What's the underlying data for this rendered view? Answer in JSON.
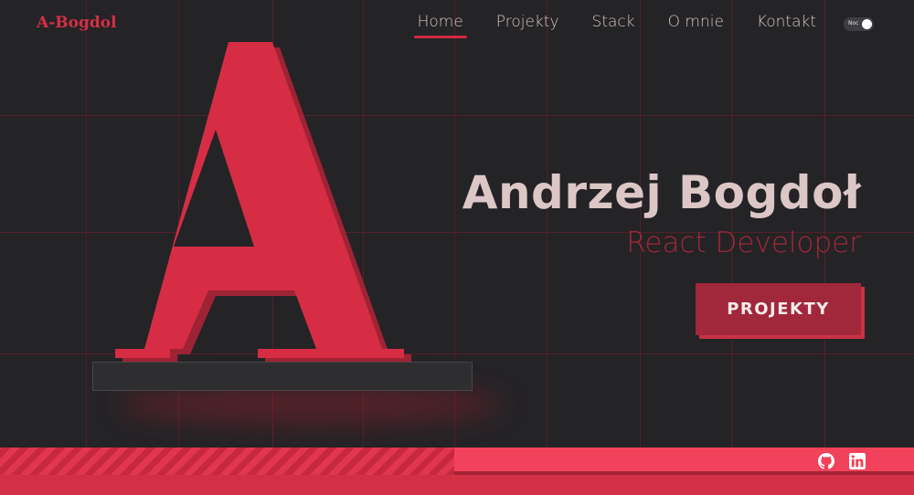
{
  "header": {
    "logo": "A-Bogdol",
    "nav": [
      {
        "label": "Home",
        "active": true
      },
      {
        "label": "Projekty",
        "active": false
      },
      {
        "label": "Stack",
        "active": false
      },
      {
        "label": "O mnie",
        "active": false
      },
      {
        "label": "Kontakt",
        "active": false
      }
    ],
    "theme_toggle_label": "Noc"
  },
  "hero": {
    "big_letter": "A",
    "name": "Andrzej Bogdoł",
    "role": "React Developer",
    "cta_label": "PROJEKTY"
  },
  "footer": {
    "icons": [
      "github-icon",
      "linkedin-icon"
    ]
  },
  "colors": {
    "background": "#242326",
    "accent": "#d42f45",
    "accent_dark": "#a0283a",
    "text": "#dcc6c6",
    "footer": "#f2415a"
  }
}
